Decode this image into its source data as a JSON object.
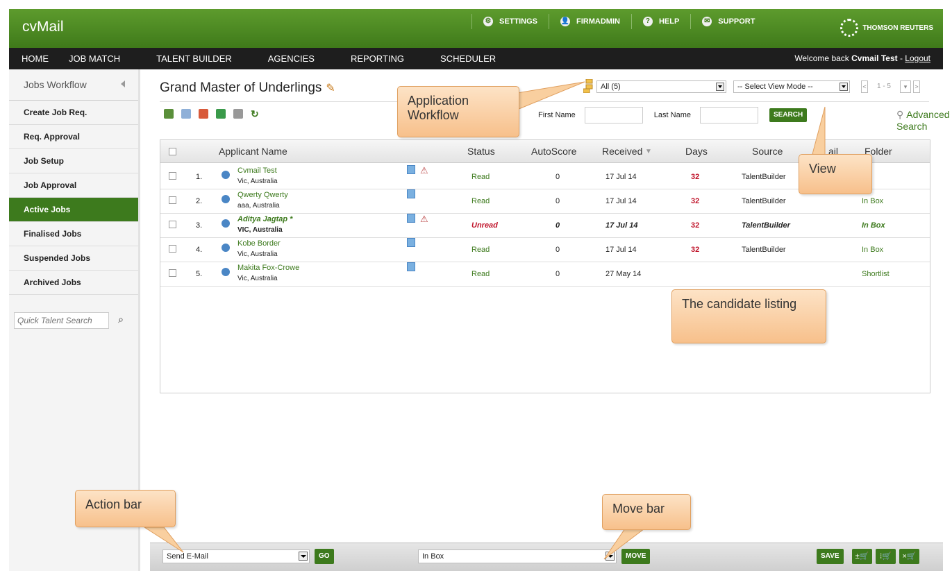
{
  "header": {
    "logo": "cvMail",
    "links": [
      {
        "label": "SETTINGS",
        "icon": "gear-icon"
      },
      {
        "label": "FIRMADMIN",
        "icon": "admin-icon"
      },
      {
        "label": "HELP",
        "icon": "help-icon"
      },
      {
        "label": "SUPPORT",
        "icon": "support-icon"
      }
    ],
    "brand": "THOMSON REUTERS"
  },
  "nav": {
    "items": [
      "HOME",
      "JOB MATCH",
      "TALENT BUILDER",
      "AGENCIES",
      "REPORTING",
      "SCHEDULER"
    ],
    "welcome_prefix": "Welcome back",
    "user": "Cvmail Test",
    "separator": "-",
    "logout": "Logout"
  },
  "sidebar": {
    "heading": "Jobs Workflow",
    "items": [
      {
        "label": "Create Job Req.",
        "active": false
      },
      {
        "label": "Req. Approval",
        "active": false
      },
      {
        "label": "Job Setup",
        "active": false
      },
      {
        "label": "Job Approval",
        "active": false
      },
      {
        "label": "Active Jobs",
        "active": true
      },
      {
        "label": "Finalised Jobs",
        "active": false
      },
      {
        "label": "Suspended Jobs",
        "active": false
      },
      {
        "label": "Archived Jobs",
        "active": false
      }
    ],
    "quick_search_placeholder": "Quick Talent Search"
  },
  "main": {
    "job_title": "Grand Master of Underlings",
    "workflow_select": "All (5)",
    "view_mode_select": "-- Select View Mode --",
    "pager": {
      "prev": "<",
      "range": "1 - 5",
      "next": ">"
    },
    "search": {
      "first_name_label": "First Name",
      "last_name_label": "Last Name",
      "search_button": "SEARCH",
      "advanced": "Advanced Search"
    },
    "table": {
      "columns": [
        "Applicant Name",
        "Status",
        "AutoScore",
        "Received",
        "Days",
        "Source",
        "ail",
        "Folder"
      ],
      "rows": [
        {
          "num": "1.",
          "name": "Cvmail Test",
          "location": "Vic, Australia",
          "status": "Read",
          "score": "0",
          "received": "17 Jul 14",
          "days": "32",
          "source": "TalentBuilder",
          "folder": "ox",
          "unread": false
        },
        {
          "num": "2.",
          "name": "Qwerty Qwerty",
          "location": "aaa, Australia",
          "status": "Read",
          "score": "0",
          "received": "17 Jul 14",
          "days": "32",
          "source": "TalentBuilder",
          "folder": "In Box",
          "unread": false
        },
        {
          "num": "3.",
          "name": "Aditya Jagtap *",
          "location": "VIC, Australia",
          "status": "Unread",
          "score": "0",
          "received": "17 Jul 14",
          "days": "32",
          "source": "TalentBuilder",
          "folder": "In Box",
          "unread": true
        },
        {
          "num": "4.",
          "name": "Kobe Border",
          "location": "Vic, Australia",
          "status": "Read",
          "score": "0",
          "received": "17 Jul 14",
          "days": "32",
          "source": "TalentBuilder",
          "folder": "In Box",
          "unread": false
        },
        {
          "num": "5.",
          "name": "Makita Fox-Crowe",
          "location": "Vic, Australia",
          "status": "Read",
          "score": "0",
          "received": "27 May 14",
          "days": "",
          "source": "",
          "folder": "Shortlist",
          "unread": false
        }
      ]
    }
  },
  "bottom": {
    "action_select": "Send E-Mail",
    "go": "GO",
    "move_select": "In Box",
    "move": "MOVE",
    "save": "SAVE",
    "cart_buttons": [
      "±🛒",
      "⁝🛒",
      "×🛒"
    ]
  },
  "callouts": {
    "workflow": "Application Workflow",
    "view": "View",
    "listing": "The candidate listing",
    "action": "Action bar",
    "move": "Move bar"
  },
  "colors": {
    "brand_green": "#3d7a1d",
    "days_red": "#c0152b",
    "callout": "#f7c08b"
  }
}
